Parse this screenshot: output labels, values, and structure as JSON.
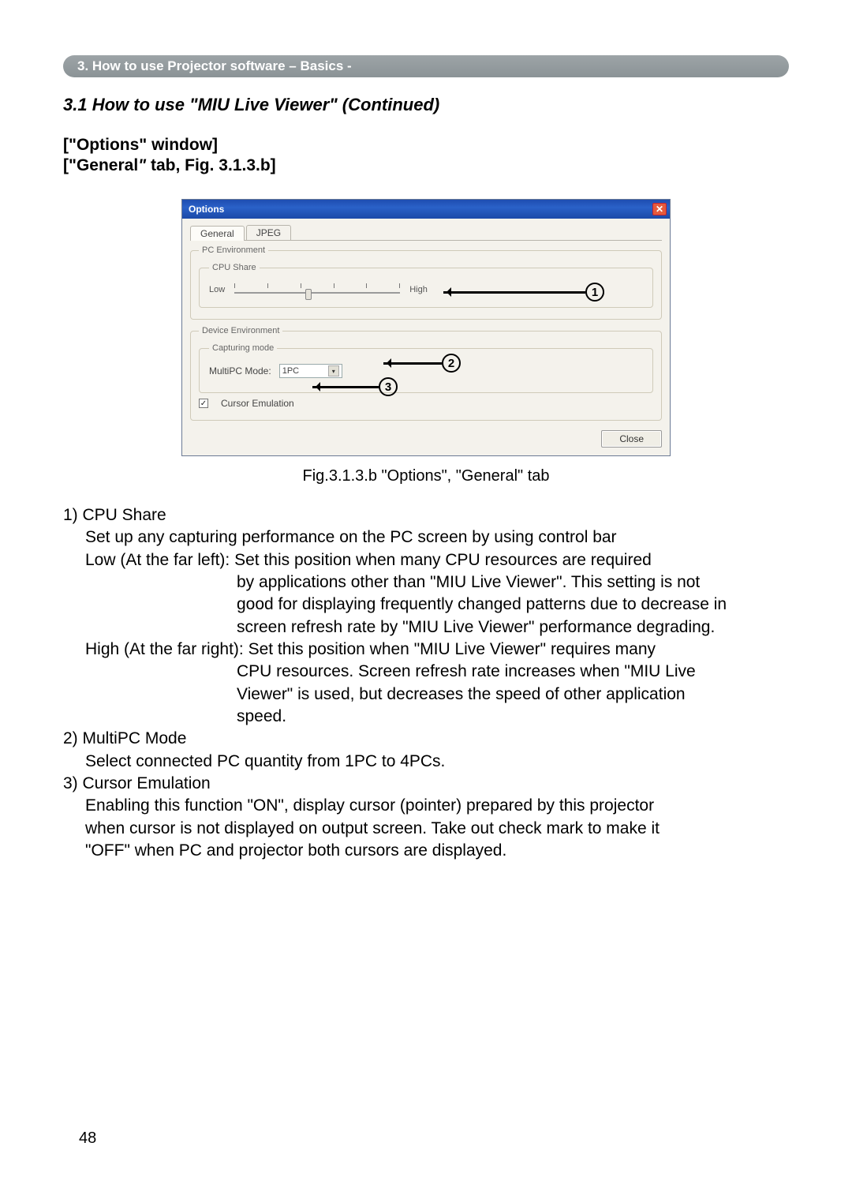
{
  "breadcrumb": "3. How to use Projector software – Basics -",
  "section_title": "3.1 How to use \"MIU Live Viewer\" (Continued)",
  "sub1": "[\"Options\" window]",
  "sub2_prefix": "[\"General",
  "sub2_italic": "\"",
  "sub2_suffix": " tab, Fig. 3.1.3.b]",
  "win": {
    "title": "Options",
    "tabs": {
      "general": "General",
      "jpeg": "JPEG"
    },
    "pc_env": "PC Environment",
    "cpu_share": "CPU Share",
    "low": "Low",
    "high": "High",
    "dev_env": "Device Environment",
    "cap_mode": "Capturing mode",
    "multipc_label": "MultiPC Mode:",
    "multipc_value": "1PC",
    "cursor_emu": "Cursor Emulation",
    "close_btn": "Close"
  },
  "callouts": {
    "c1": "1",
    "c2": "2",
    "c3": "3"
  },
  "fig_caption": "Fig.3.1.3.b \"Options\", \"General\" tab",
  "body": {
    "l1": "1) CPU Share",
    "l2": "Set up any capturing performance on the PC screen by using control bar",
    "l3": "Low (At the far left): Set this position when many CPU resources are required",
    "l3b": "by applications other than \"MIU Live Viewer\". This setting is not",
    "l3c": "good for displaying frequently changed patterns due to decrease in",
    "l3d": "screen refresh rate by \"MIU Live Viewer\" performance degrading.",
    "l4": "High (At the far right): Set this position when \"MIU Live Viewer\" requires many",
    "l4b": "CPU resources. Screen refresh rate increases when \"MIU Live",
    "l4c": "Viewer\" is used, but decreases the speed of other application",
    "l4d": "speed.",
    "l5": "2) MultiPC Mode",
    "l6": "Select connected PC quantity from 1PC to 4PCs.",
    "l7": "3) Cursor Emulation",
    "l8": "Enabling this function \"ON\", display cursor (pointer) prepared by this projector",
    "l9": "when cursor is not displayed on output screen. Take out check mark to make it",
    "l10": "\"OFF\" when PC and projector both cursors are displayed."
  },
  "page_number": "48"
}
